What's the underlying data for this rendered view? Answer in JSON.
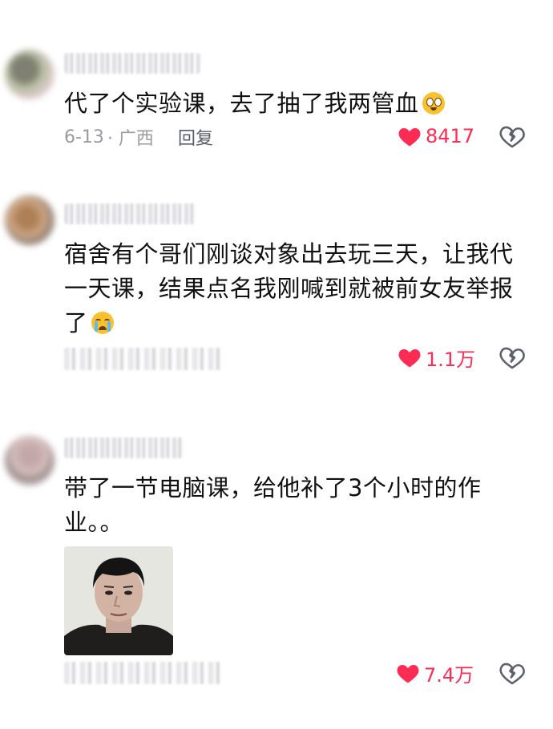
{
  "comments": [
    {
      "text": "代了个实验课，去了抽了我两管血",
      "date": "6-13",
      "location": "· 广西",
      "reply": "回复",
      "likes": "8417"
    },
    {
      "text": "宿舍有个哥们刚谈对象出去玩三天，让我代一天课，结果点名我刚喊到就被前女友举报了",
      "likes": "1.1万"
    },
    {
      "text": "带了一节电脑课，给他补了3个小时的作业。。",
      "likes": "7.4万"
    }
  ],
  "colors": {
    "like": "#fe2c55",
    "meta": "#9a9aa0",
    "text": "#111111"
  },
  "icons": {
    "like": "heart-filled-icon",
    "dislike": "broken-heart-icon",
    "emoji1": "flushed-face-emoji",
    "emoji2": "crying-face-emoji"
  }
}
